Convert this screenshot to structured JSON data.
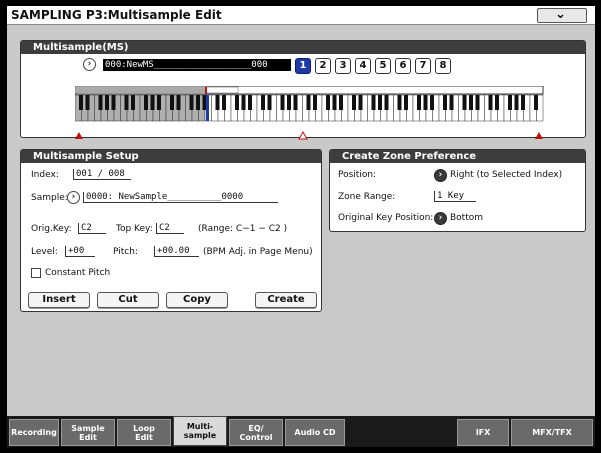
{
  "title": "SAMPLING P3:Multisample Edit",
  "menu_icon": "chevron-down-icon",
  "multisample": {
    "header": "Multisample(MS)",
    "name": "000:NewMS__________________000",
    "index_buttons": [
      "1",
      "2",
      "3",
      "4",
      "5",
      "6",
      "7",
      "8"
    ],
    "selected_index": "1"
  },
  "setup": {
    "header": "Multisample Setup",
    "index_label": "Index:",
    "index_value": "001 / 008",
    "sample_label": "Sample:",
    "sample_value": "0000: NewSample__________0000",
    "origkey_label": "Orig.Key:",
    "origkey_value": "C2",
    "topkey_label": "Top Key:",
    "topkey_value": "C2",
    "range_text": "(Range: C−1  − C2   )",
    "level_label": "Level:",
    "level_value": "+00",
    "pitch_label": "Pitch:",
    "pitch_value": "+00.00",
    "pitch_note": "(BPM Adj. in Page Menu)",
    "constant_pitch_label": "Constant Pitch",
    "buttons": {
      "insert": "Insert",
      "cut": "Cut",
      "copy": "Copy",
      "create": "Create"
    }
  },
  "zone_pref": {
    "header": "Create Zone Preference",
    "position_label": "Position:",
    "position_value": "Right (to Selected Index)",
    "zone_range_label": "Zone Range:",
    "zone_range_value": "1 Key",
    "orig_key_pos_label": "Original Key Position:",
    "orig_key_pos_value": "Bottom"
  },
  "tabs": [
    {
      "label": "Recording"
    },
    {
      "label": "Sample\nEdit"
    },
    {
      "label": "Loop\nEdit"
    },
    {
      "label": "Multi-\nsample"
    },
    {
      "label": "EQ/\nControl"
    },
    {
      "label": "Audio CD"
    },
    {
      "label": "IFX"
    },
    {
      "label": "MFX/TFX"
    }
  ],
  "active_tab": "Multi-\nsample"
}
